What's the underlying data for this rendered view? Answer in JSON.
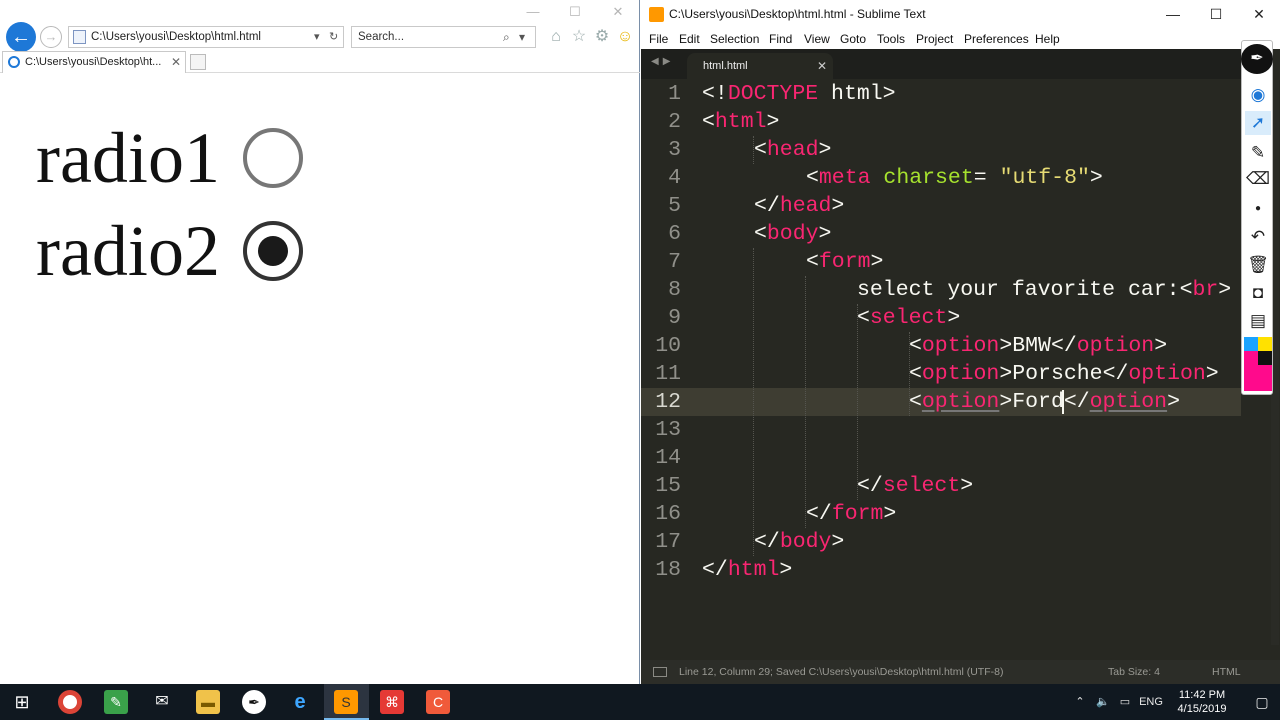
{
  "browser": {
    "address": "C:\\Users\\yousi\\Desktop\\html.html",
    "search_placeholder": "Search...",
    "tab_label": "C:\\Users\\yousi\\Desktop\\ht...",
    "content": {
      "radios": [
        {
          "label": "radio1",
          "checked": false
        },
        {
          "label": "radio2",
          "checked": true
        }
      ]
    }
  },
  "sublime": {
    "title": "C:\\Users\\yousi\\Desktop\\html.html - Sublime Text",
    "menu": [
      "File",
      "Edit",
      "Selection",
      "Find",
      "View",
      "Goto",
      "Tools",
      "Project",
      "Preferences",
      "Help"
    ],
    "tab_label": "html.html",
    "line_numbers": [
      "1",
      "2",
      "3",
      "4",
      "5",
      "6",
      "7",
      "8",
      "9",
      "10",
      "11",
      "12",
      "13",
      "14",
      "15",
      "16",
      "17",
      "18"
    ],
    "code": {
      "l1_open": "<!",
      "l1_doctype": "DOCTYPE",
      "l1_rest": " html>",
      "l2_lt": "<",
      "l2_tag": "html",
      "l2_gt": ">",
      "l3_lt": "<",
      "l3_tag": "head",
      "l3_gt": ">",
      "l4_lt": "<",
      "l4_tag": "meta",
      "l4_sp": " ",
      "l4_attr": "charset",
      "l4_eq": "= ",
      "l4_str": "\"utf-8\"",
      "l4_gt": ">",
      "l5_lt": "</",
      "l5_tag": "head",
      "l5_gt": ">",
      "l6_lt": "<",
      "l6_tag": "body",
      "l6_gt": ">",
      "l7_lt": "<",
      "l7_tag": "form",
      "l7_gt": ">",
      "l8_text": "select your favorite car:",
      "l8_lt": "<",
      "l8_tag": "br",
      "l8_gt": ">",
      "l9_lt": "<",
      "l9_tag": "select",
      "l9_gt": ">",
      "l10_lt": "<",
      "l10_tag": "option",
      "l10_gt": ">",
      "l10_text": "BMW",
      "l10_clt": "</",
      "l10_ctag": "option",
      "l10_cgt": ">",
      "l11_lt": "<",
      "l11_tag": "option",
      "l11_gt": ">",
      "l11_text": "Porsche",
      "l11_clt": "</",
      "l11_ctag": "option",
      "l11_cgt": ">",
      "l12_lt": "<",
      "l12_tag": "option",
      "l12_gt": ">",
      "l12_text": "Ford",
      "l12_clt": "</",
      "l12_ctag": "option",
      "l12_cgt": ">",
      "l15_lt": "</",
      "l15_tag": "select",
      "l15_gt": ">",
      "l16_lt": "</",
      "l16_tag": "form",
      "l16_gt": ">",
      "l17_lt": "</",
      "l17_tag": "body",
      "l17_gt": ">",
      "l18_lt": "</",
      "l18_tag": "html",
      "l18_gt": ">"
    },
    "status_left": "Line 12, Column 29; Saved C:\\Users\\yousi\\Desktop\\html.html (UTF-8)",
    "status_tabsize": "Tab Size: 4",
    "status_syntax": "HTML"
  },
  "taskbar": {
    "lang": "ENG",
    "time": "11:42 PM",
    "date": "4/15/2019"
  },
  "colors": {
    "editor_bg": "#272822",
    "tag": "#f92672",
    "attr": "#a6e22e",
    "string": "#e6db74",
    "ie_accent": "#1e78d7"
  }
}
